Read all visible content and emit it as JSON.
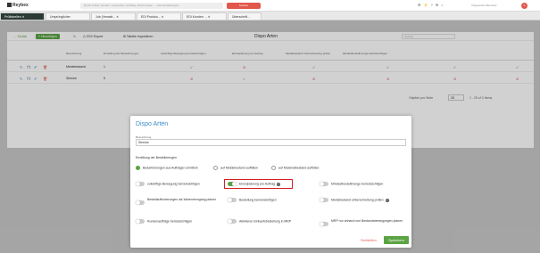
{
  "app": {
    "logo": "Reybex",
    "search_placeholder": "Durch Artikel, Kunden, Lieferanten, Aufträge, Rechnungen ... oder Einstellungen",
    "search_button": "Suchen",
    "user_label": "Vorgesetzte Benutzer"
  },
  "tabs": [
    {
      "label": "Prüftabellen"
    },
    {
      "label": "Ursprünglicher"
    },
    {
      "label": "Job (Verwalt..."
    },
    {
      "label": "EDI Protoko..."
    },
    {
      "label": "EDI Kunden ..."
    },
    {
      "label": "Überschrift..."
    }
  ],
  "toolbar": {
    "back": "← Zurück",
    "new": "+ Hinzufügen",
    "csv": "CSV Export",
    "import": "Tabelle importieren",
    "title": "Dispo Arten",
    "filter_placeholder": "Suchen"
  },
  "table": {
    "headers": [
      "Bezeichnung",
      "Ermittlung der Bestellmengen",
      "zukünftige Bewegung berücksichtigen",
      "Einzelplanung pro Auftrag",
      "Meldebestand Unterschreitung prüfen",
      "Mindestbestellmenge berücksichtigen",
      "Bestellaufforderungen als Warenrenngang planen",
      "Bestellung berücksichtigen",
      "Meldebestand..."
    ],
    "rows": [
      {
        "name": "Meldebestand",
        "value": "1"
      },
      {
        "name": "Strecke",
        "value": "5"
      }
    ],
    "per_page_label": "Objekte pro Seite",
    "per_page": "25",
    "range": "1 - 25 of 2 Items"
  },
  "modal": {
    "title": "Dispo Arten",
    "field_label": "Bezeichnung",
    "field_value": "Strecke",
    "section": "Ermittlung der Bestellmengen",
    "radios": [
      {
        "label": "Bedarfsmengen aus Aufträgen ermitteln",
        "checked": true
      },
      {
        "label": "auf Meldebestand auffüllen",
        "checked": false
      },
      {
        "label": "auf Maximalbestand auffüllen",
        "checked": false
      }
    ],
    "options": {
      "opt1": "zukünftige Bewegung berücksichtigen",
      "opt2": "Einzelplanung pro Auftrag",
      "opt3": "Mindestbestellmenge berücksichtigen",
      "opt4": "Bestellaufforderungen als Warenrenngang planen",
      "opt5": "Bestellung berücksichtigen",
      "opt6": "Meldebestand Unterschreitung prüfen",
      "opt7": "Kundenaufträge berücksichtigen",
      "opt8": "Aktivieren Einkaufsbestellung in MRP",
      "opt9": "MRP nur anhand von Bestandsbewegungen planen"
    },
    "close": "Schließen",
    "save": "Speichern"
  }
}
